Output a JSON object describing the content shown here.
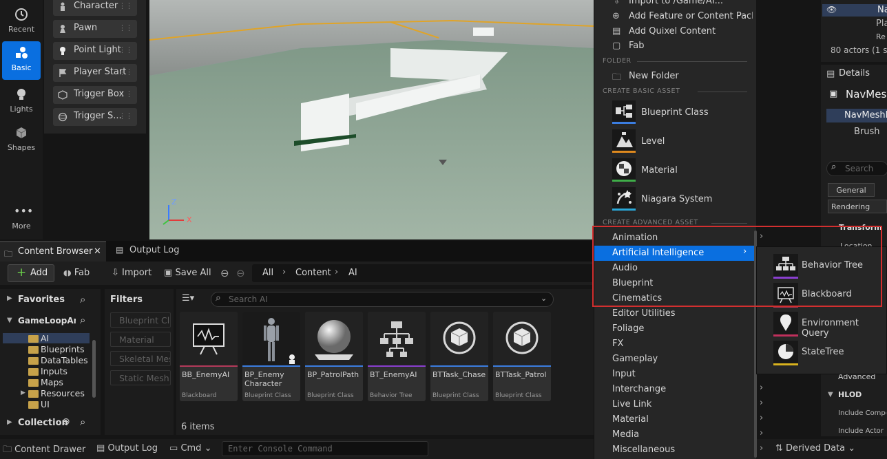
{
  "mode_bar": {
    "items": [
      {
        "label": "Recent",
        "icon": "clock-icon"
      },
      {
        "label": "Basic",
        "icon": "shapes-basic-icon",
        "active": true
      },
      {
        "label": "Lights",
        "icon": "bulb-icon"
      },
      {
        "label": "Shapes",
        "icon": "cube-icon"
      },
      {
        "label": "More",
        "icon": "more-icon"
      }
    ]
  },
  "place_actors": {
    "items": [
      {
        "label": "Character"
      },
      {
        "label": "Pawn"
      },
      {
        "label": "Point Light"
      },
      {
        "label": "Player Start"
      },
      {
        "label": "Trigger Box"
      },
      {
        "label": "Trigger S..."
      }
    ]
  },
  "viewport": {
    "axis_x": "X",
    "axis_z": "Z"
  },
  "content_browser": {
    "tabs": [
      {
        "label": "Content Browser"
      },
      {
        "label": "Output Log"
      }
    ],
    "toolbar": {
      "add": "Add",
      "fab": "Fab",
      "import": "Import",
      "save_all": "Save All"
    },
    "breadcrumb": [
      "All",
      "Content",
      "AI"
    ],
    "sidebar": {
      "favorites": "Favorites",
      "project": "GameLoopAnd",
      "folders": [
        "AI",
        "Blueprints",
        "DataTables",
        "Inputs",
        "Maps",
        "Resources",
        "UI"
      ],
      "collection": "Collection"
    },
    "filters": {
      "title": "Filters",
      "items": [
        "Blueprint Cla",
        "Material",
        "Skeletal Mes",
        "Static Mesh"
      ]
    },
    "search_placeholder": "Search AI",
    "assets": [
      {
        "name": "BB_EnemyAI",
        "type": "Blackboard",
        "color": "#b43a5a",
        "thumb": "blackboard"
      },
      {
        "name": "BP_Enemy Character",
        "type": "Blueprint Class",
        "color": "#3b7de0",
        "thumb": "character"
      },
      {
        "name": "BP_PatrolPath",
        "type": "Blueprint Class",
        "color": "#3b7de0",
        "thumb": "sphere"
      },
      {
        "name": "BT_EnemyAI",
        "type": "Behavior Tree",
        "color": "#8a3fd0",
        "thumb": "tree"
      },
      {
        "name": "BTTask_Chase",
        "type": "Blueprint Class",
        "color": "#3b7de0",
        "thumb": "box"
      },
      {
        "name": "BTTask_Patrol",
        "type": "Blueprint Class",
        "color": "#3b7de0",
        "thumb": "box"
      }
    ],
    "item_count": "6 items"
  },
  "status_bar": {
    "content_drawer": "Content Drawer",
    "output_log": "Output Log",
    "cmd": "Cmd",
    "console_placeholder": "Enter Console Command",
    "derived_data": "Derived Data"
  },
  "add_menu": {
    "top_items": [
      "Import to /Game/AI...",
      "Add Feature or Content Pack...",
      "Add Quixel Content",
      "Fab"
    ],
    "folder_section": "FOLDER",
    "new_folder": "New Folder",
    "basic_section": "CREATE BASIC ASSET",
    "basic_assets": [
      {
        "label": "Blueprint Class",
        "color": "#3b7de0"
      },
      {
        "label": "Level",
        "color": "#e08a1e"
      },
      {
        "label": "Material",
        "color": "#3fae49"
      },
      {
        "label": "Niagara System",
        "color": "#2aa8d8"
      }
    ],
    "advanced_section": "CREATE ADVANCED ASSET",
    "categories": [
      "Animation",
      "Artificial Intelligence",
      "Audio",
      "Blueprint",
      "Cinematics",
      "Editor Utilities",
      "Foliage",
      "FX",
      "Gameplay",
      "Input",
      "Interchange",
      "Live Link",
      "Material",
      "Media",
      "Miscellaneous"
    ],
    "selected_category": "Artificial Intelligence"
  },
  "ai_submenu": [
    {
      "label": "Behavior Tree",
      "color": "#8a3fd0"
    },
    {
      "label": "Blackboard",
      "color": "#b43a5a"
    },
    {
      "label": "Environment Query",
      "color": "#c0305c"
    },
    {
      "label": "StateTree",
      "color": "#d8b21e"
    }
  ],
  "outliner": {
    "row1": "Na",
    "row2": "Pla",
    "row3": "Re",
    "actors": "80 actors (1 se"
  },
  "details": {
    "title": "Details",
    "actor": "NavMeshB",
    "component": "NavMeshB",
    "brush": "Brush",
    "search": "Search",
    "tabs": [
      "General",
      "Rendering"
    ],
    "transform": "Transform",
    "location": "Location",
    "advanced": "Advanced",
    "hlod": "HLOD",
    "include_comp": "Include Compo",
    "include_actor": "Include Actor i"
  }
}
